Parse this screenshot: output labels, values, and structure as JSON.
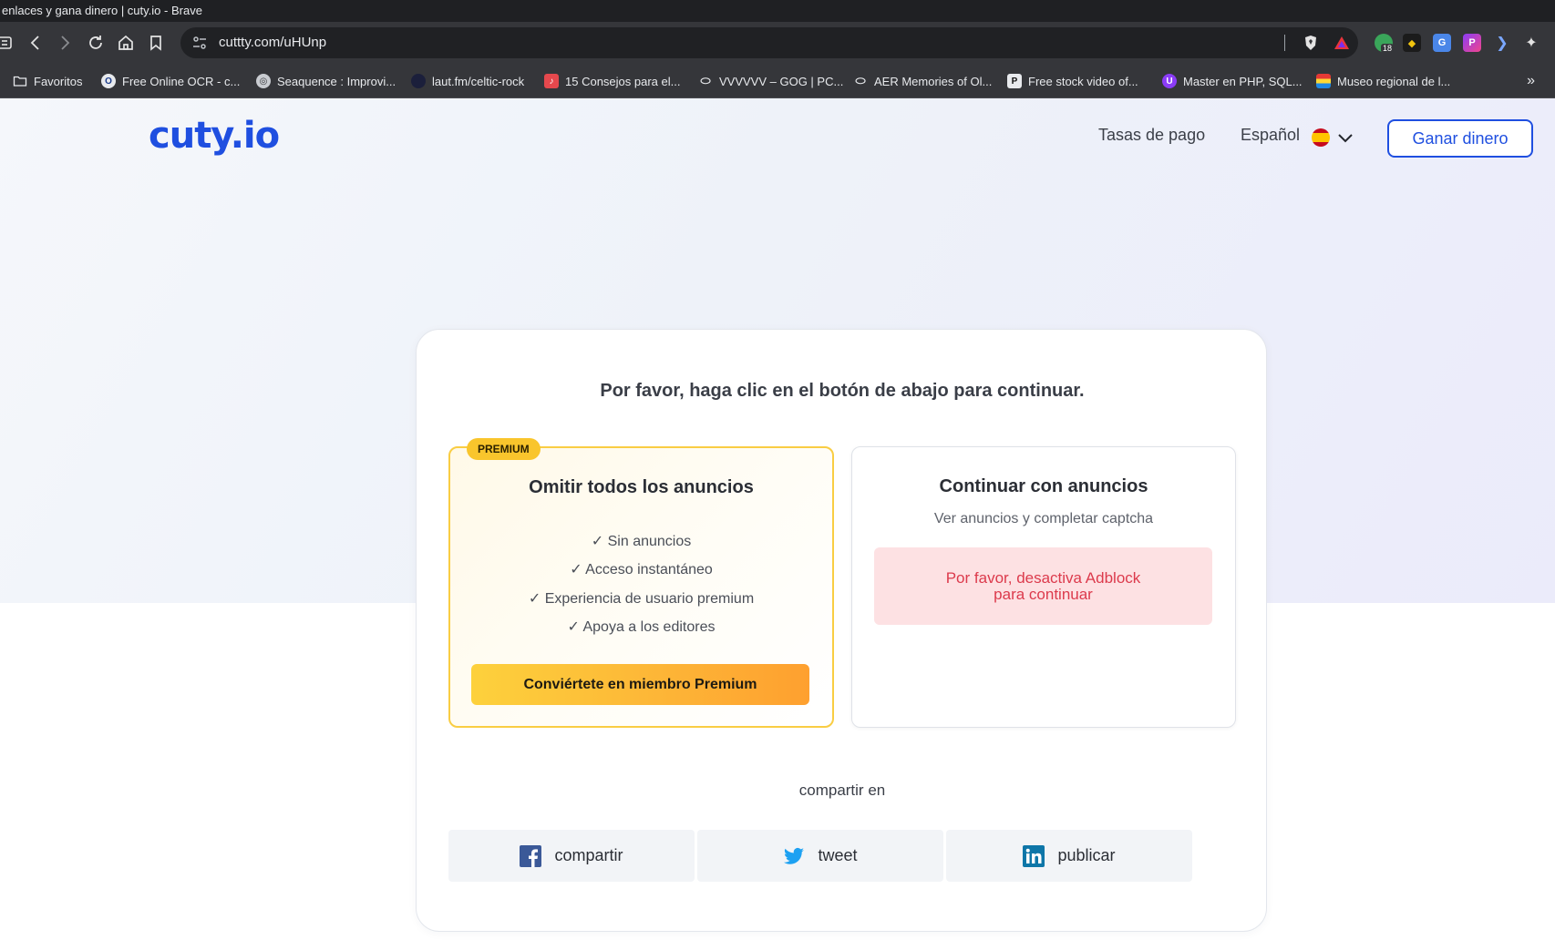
{
  "browser": {
    "window_title": "enlaces y gana dinero | cuty.io - Brave",
    "url": "cuttty.com/uHUnp",
    "extension_badge": "18",
    "bookmarks": [
      {
        "label": "Favoritos",
        "icon": "folder-icon"
      },
      {
        "label": "Free Online OCR - c...",
        "icon": "ocr-favicon"
      },
      {
        "label": "Seaquence : Improvi...",
        "icon": "globe-icon"
      },
      {
        "label": "laut.fm/celtic-rock",
        "icon": "laut-favicon"
      },
      {
        "label": "15 Consejos para el...",
        "icon": "music-favicon"
      },
      {
        "label": "VVVVVV – GOG | PC...",
        "icon": "gog-favicon"
      },
      {
        "label": "AER Memories of Ol...",
        "icon": "gog-favicon"
      },
      {
        "label": "Free stock video of...",
        "icon": "pexels-favicon"
      },
      {
        "label": "Master en PHP, SQL...",
        "icon": "course-favicon"
      },
      {
        "label": "Museo regional de l...",
        "icon": "museum-favicon"
      }
    ]
  },
  "header": {
    "logo": "cuty.io",
    "nav_rates": "Tasas de pago",
    "nav_language": "Español",
    "earn_button": "Ganar dinero"
  },
  "main": {
    "title": "Por favor, haga clic en el botón de abajo para continuar.",
    "premium": {
      "badge": "PREMIUM",
      "title": "Omitir todos los anuncios",
      "features": [
        "✓ Sin anuncios",
        "✓ Acceso instantáneo",
        "✓ Experiencia de usuario premium",
        "✓ Apoya a los editores"
      ],
      "button": "Conviértete en miembro Premium"
    },
    "ads": {
      "title": "Continuar con anuncios",
      "subtitle": "Ver anuncios y completar captcha",
      "adblock_line1": "Por favor, desactiva Adblock",
      "adblock_line2": "para continuar"
    },
    "share": {
      "label": "compartir en",
      "facebook": "compartir",
      "twitter": "tweet",
      "linkedin": "publicar"
    }
  },
  "colors": {
    "brand": "#1f4fe0",
    "premium_border": "#f9cd43",
    "adblock_bg": "#fde1e3",
    "adblock_text": "#dc3a4c"
  }
}
